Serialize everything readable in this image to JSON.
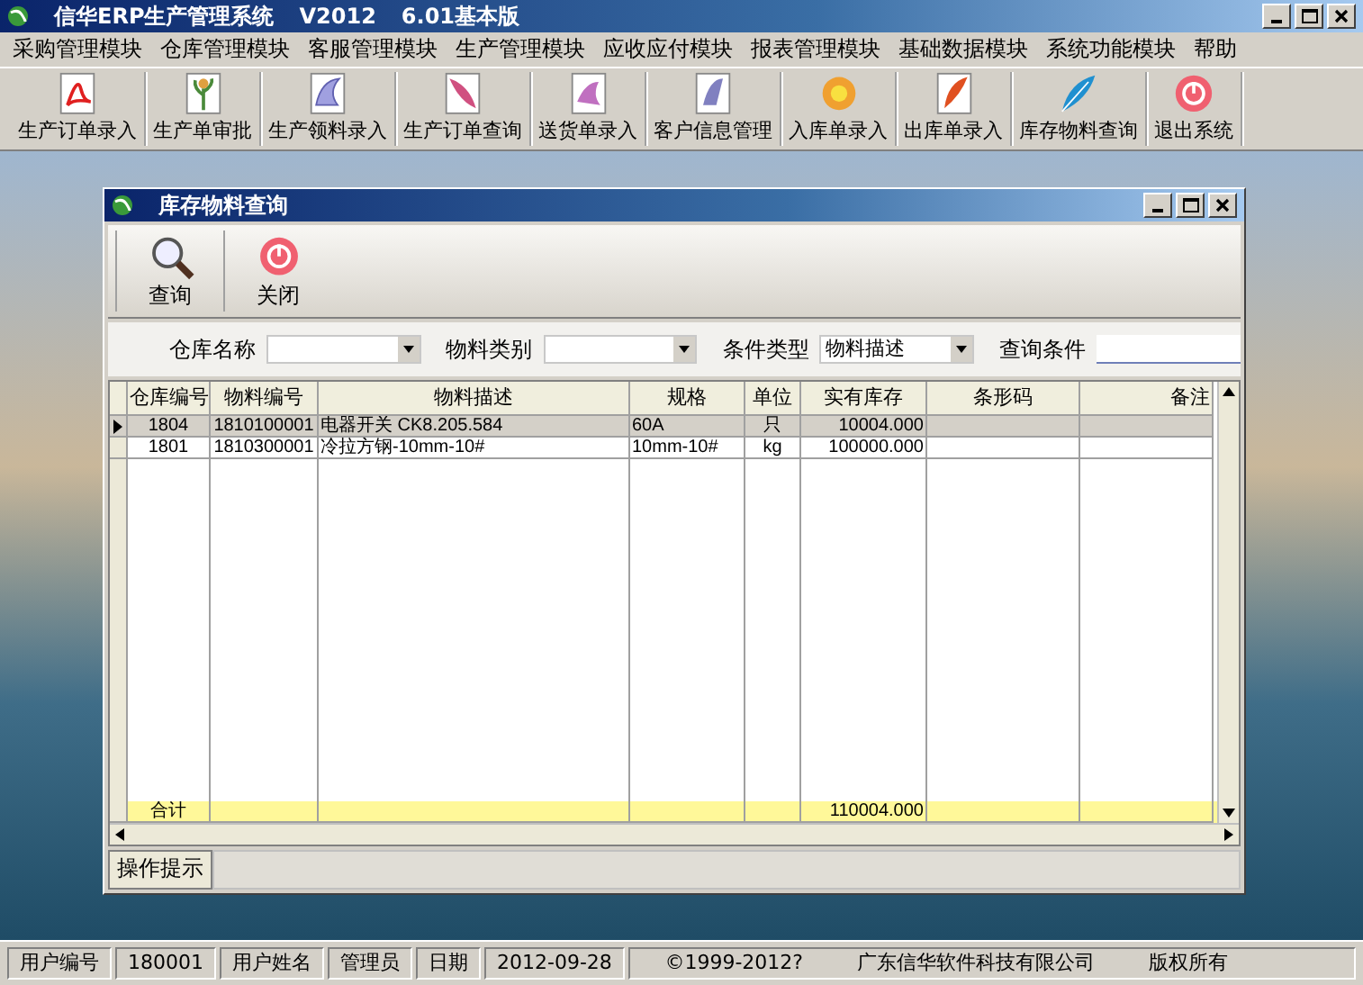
{
  "window": {
    "title": "信华ERP生产管理系统",
    "version": "V2012",
    "edition": "6.01基本版"
  },
  "menu": [
    "采购管理模块",
    "仓库管理模块",
    "客服管理模块",
    "生产管理模块",
    "应收应付模块",
    "报表管理模块",
    "基础数据模块",
    "系统功能模块",
    "帮助"
  ],
  "toolbar": [
    {
      "label": "生产订单录入"
    },
    {
      "label": "生产单审批"
    },
    {
      "label": "生产领料录入"
    },
    {
      "label": "生产订单查询"
    },
    {
      "label": "送货单录入"
    },
    {
      "label": "客户信息管理"
    },
    {
      "label": "入库单录入"
    },
    {
      "label": "出库单录入"
    },
    {
      "label": "库存物料查询"
    },
    {
      "label": "退出系统"
    }
  ],
  "child_window": {
    "title": "库存物料查询",
    "toolbar": [
      {
        "label": "查询"
      },
      {
        "label": "关闭"
      }
    ],
    "filters": [
      {
        "label": "仓库名称",
        "kind": "combo"
      },
      {
        "label": "物料类别",
        "kind": "combo"
      },
      {
        "label": "条件类型",
        "kind": "combo",
        "value": "物料描述"
      },
      {
        "label": "查询条件",
        "kind": "text"
      }
    ],
    "table": {
      "columns": [
        "仓库编号",
        "物料编号",
        "物料描述",
        "规格",
        "单位",
        "实有库存",
        "条形码",
        "备注"
      ],
      "rows": [
        {
          "selected": true,
          "cells": [
            "1804",
            "1810100001",
            "电器开关 CK8.205.584",
            "60A",
            "只",
            "10004.000"
          ]
        },
        {
          "selected": false,
          "cells": [
            "1801",
            "1810300001",
            "冷拉方钢-10mm-10#",
            "10mm-10#",
            "kg",
            "100000.000"
          ]
        }
      ],
      "total_row": {
        "label": "合计",
        "stock": "110004.000"
      }
    },
    "hint_label": "操作提示"
  },
  "status_bar": {
    "fields": [
      {
        "label": "用户编号",
        "value": "180001"
      },
      {
        "label": "用户姓名",
        "value": "管理员"
      },
      {
        "label": "日期",
        "value": "2012-09-28"
      }
    ],
    "copyright": "©1999-2012?",
    "company": "广东信华软件科技有限公司",
    "rights": "版权所有"
  }
}
